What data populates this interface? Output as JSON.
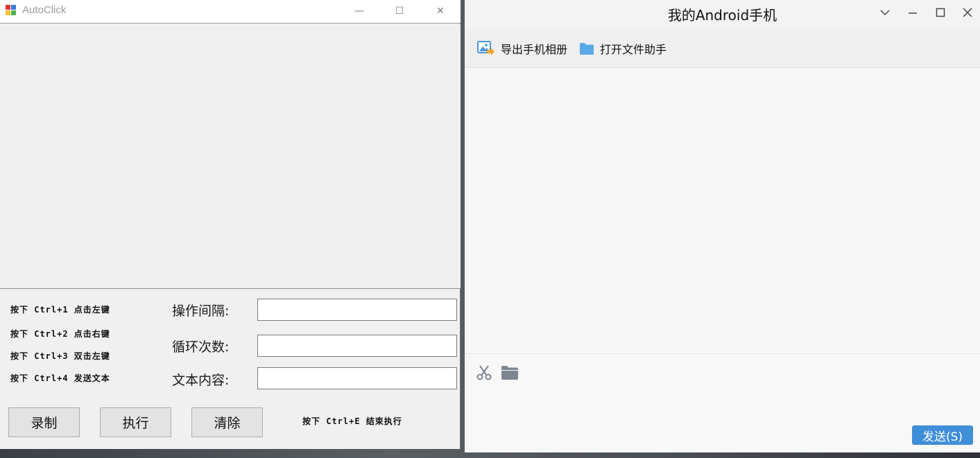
{
  "autoclick": {
    "title": "AutoClick",
    "hints": [
      "按下 Ctrl+1 点击左键",
      "按下 Ctrl+2 点击右键",
      "按下 Ctrl+3 双击左键",
      "按下 Ctrl+4 发送文本"
    ],
    "fields": {
      "interval_label": "操作间隔:",
      "interval_value": "",
      "loop_label": "循环次数:",
      "loop_value": "",
      "text_label": "文本内容:",
      "text_value": ""
    },
    "buttons": {
      "record": "录制",
      "execute": "执行",
      "clear": "清除"
    },
    "end_hint": "按下 Ctrl+E 结束执行",
    "window_controls": {
      "minimize": "—",
      "maximize": "☐",
      "close": "✕"
    }
  },
  "phone": {
    "title": "我的Android手机",
    "toolbar": {
      "export_album": "导出手机相册",
      "open_file_helper": "打开文件助手"
    },
    "send_button": "发送(S)",
    "message_value": "",
    "colors": {
      "accent": "#3e8ed8",
      "folder": "#5aa9e6",
      "export_arrow": "#f5a623"
    }
  }
}
